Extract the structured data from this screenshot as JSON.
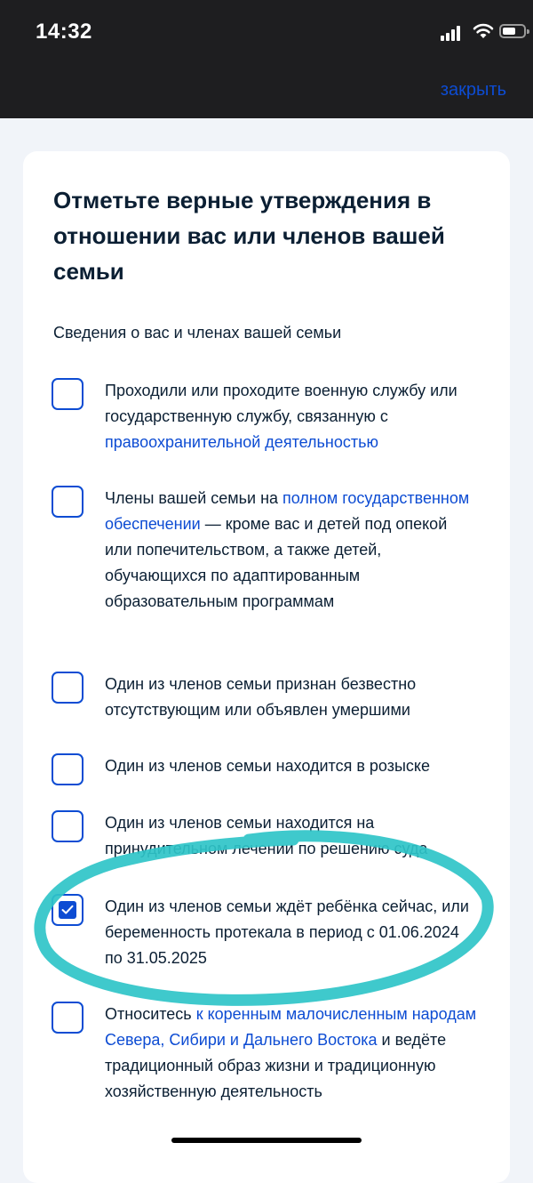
{
  "status_bar": {
    "time": "14:32"
  },
  "header": {
    "close_label": "закрыть"
  },
  "form": {
    "title": "Отметьте верные утверждения в отношении вас или членов вашей семьи",
    "subtitle": "Сведения о вас и членах вашей семьи",
    "items": [
      {
        "checked": false,
        "text_a": "Проходили или проходите военную службу или государственную службу, связанную с ",
        "link_a": "правоохранительной деятельностью"
      },
      {
        "checked": false,
        "text_a": "Члены вашей семьи на ",
        "link_a": "полном государственном обеспечении",
        "text_b": " — кроме вас и детей под опекой или попечительством, а также детей, обучающихся по адаптированным образовательным программам"
      },
      {
        "checked": false,
        "text_a": "Один из членов семьи признан безвестно отсутствующим или объявлен умершими"
      },
      {
        "checked": false,
        "text_a": "Один из членов семьи находится в розыске"
      },
      {
        "checked": false,
        "text_a": "Один из членов семьи находится на принудительном лечении по решению суда"
      },
      {
        "checked": true,
        "text_a": "Один из членов семьи ждёт ребёнка сейчас, или беременность протекала в период с 01.06.2024 по 31.05.2025"
      },
      {
        "checked": false,
        "text_a": "Относитесь ",
        "link_a": "к коренным малочисленным народам Севера, Сибири и Дальнего Востока",
        "text_b": " и ведёте традиционный образ жизни и традиционную хозяйственную деятельность"
      }
    ]
  },
  "colors": {
    "accent": "#0d4cd3",
    "top_bar": "#1e1e20",
    "annotation_stroke": "#2fc4c8"
  },
  "icons": [
    "cellular-signal-icon",
    "wifi-icon",
    "battery-icon",
    "checkmark-icon"
  ]
}
